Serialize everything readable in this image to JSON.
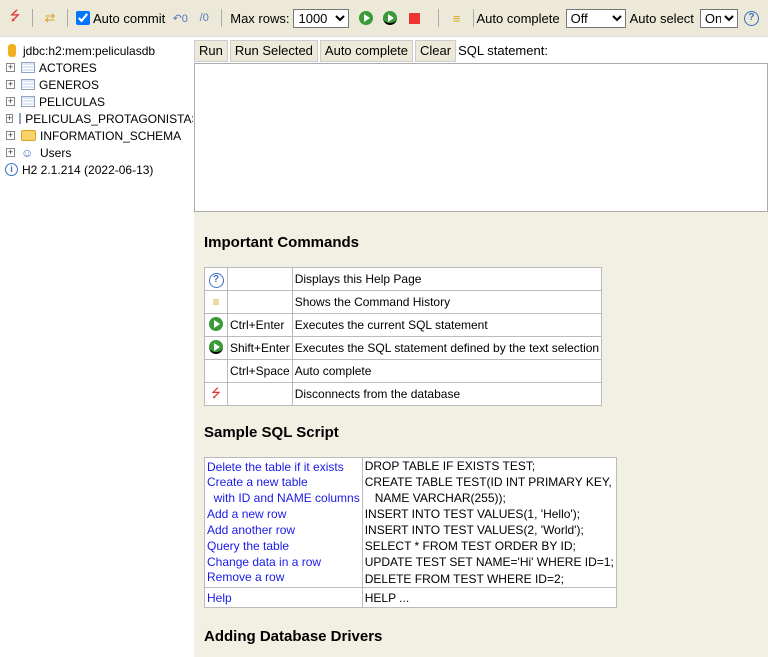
{
  "toolbar": {
    "auto_commit_label": "Auto commit",
    "auto_commit_checked": true,
    "max_rows_label": "Max rows:",
    "max_rows_value": "1000",
    "auto_complete_label": "Auto complete",
    "auto_complete_value": "Off",
    "auto_select_label": "Auto select",
    "auto_select_value": "On"
  },
  "tree": {
    "connection": "jdbc:h2:mem:peliculasdb",
    "items": [
      {
        "label": "ACTORES",
        "icon": "table-icon"
      },
      {
        "label": "GENEROS",
        "icon": "table-icon"
      },
      {
        "label": "PELICULAS",
        "icon": "table-icon"
      },
      {
        "label": "PELICULAS_PROTAGONISTAS",
        "icon": "table-icon"
      },
      {
        "label": "INFORMATION_SCHEMA",
        "icon": "folder-icon"
      },
      {
        "label": "Users",
        "icon": "users-icon"
      }
    ],
    "version": "H2 2.1.214 (2022-06-13)"
  },
  "editor": {
    "run": "Run",
    "run_selected": "Run Selected",
    "auto_complete": "Auto complete",
    "clear": "Clear",
    "sql_label": "SQL statement:"
  },
  "help": {
    "important_title": "Important Commands",
    "commands": [
      {
        "icon": "help-icon",
        "keys": "",
        "desc": "Displays this Help Page"
      },
      {
        "icon": "history-icon",
        "keys": "",
        "desc": "Shows the Command History"
      },
      {
        "icon": "run-icon",
        "keys": "Ctrl+Enter",
        "desc": "Executes the current SQL statement"
      },
      {
        "icon": "run-selected-icon",
        "keys": "Shift+Enter",
        "desc": "Executes the SQL statement defined by the text selection"
      },
      {
        "icon": "",
        "keys": "Ctrl+Space",
        "desc": "Auto complete"
      },
      {
        "icon": "disconnect-icon",
        "keys": "",
        "desc": "Disconnects from the database"
      }
    ],
    "sample_title": "Sample SQL Script",
    "sample": [
      {
        "link": "Delete the table if it exists",
        "sql": "DROP TABLE IF EXISTS TEST;"
      },
      {
        "link": "Create a new table",
        "sql": "CREATE TABLE TEST(ID INT PRIMARY KEY,"
      },
      {
        "link": "  with ID and NAME columns",
        "sql": "   NAME VARCHAR(255));"
      },
      {
        "link": "Add a new row",
        "sql": "INSERT INTO TEST VALUES(1, 'Hello');"
      },
      {
        "link": "Add another row",
        "sql": "INSERT INTO TEST VALUES(2, 'World');"
      },
      {
        "link": "Query the table",
        "sql": "SELECT * FROM TEST ORDER BY ID;"
      },
      {
        "link": "Change data in a row",
        "sql": "UPDATE TEST SET NAME='Hi' WHERE ID=1;"
      },
      {
        "link": "Remove a row",
        "sql": "DELETE FROM TEST WHERE ID=2;"
      }
    ],
    "help_link": "Help",
    "help_sql": "HELP ...",
    "drivers_title": "Adding Database Drivers"
  }
}
